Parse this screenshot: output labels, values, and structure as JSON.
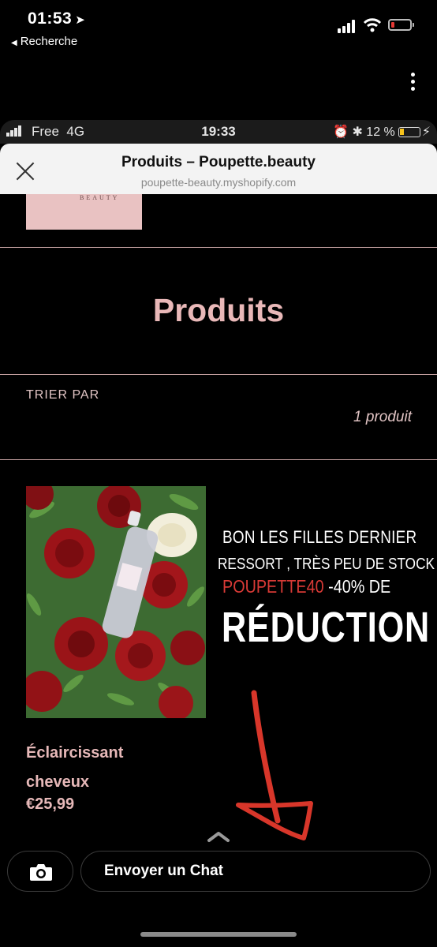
{
  "outer_status": {
    "time": "01:53",
    "back_label": "Recherche"
  },
  "inner_status": {
    "carrier": "Free",
    "network": "4G",
    "time": "19:33",
    "battery_text": "12 %"
  },
  "browser": {
    "title": "Produits – Poupette.beauty",
    "url": "poupette-beauty.myshopify.com"
  },
  "page": {
    "logo_text": "BEAUTY",
    "title": "Produits",
    "sort_label": "TRIER PAR",
    "count": "1 produit"
  },
  "overlay": {
    "line1": "BON LES FILLES DERNIER",
    "line2": "RESSORT , TRÈS PEU DE STOCK ,",
    "code": "POUPETTE40",
    "discount": " -40% DE",
    "line4": "RÉDUCTION"
  },
  "product": {
    "name": "Éclaircissant cheveux",
    "price": "€25,99"
  },
  "chat": {
    "placeholder": "Envoyer un Chat"
  },
  "colors": {
    "accent_pink": "#e9b8b8",
    "promo_red": "#d93a36"
  }
}
